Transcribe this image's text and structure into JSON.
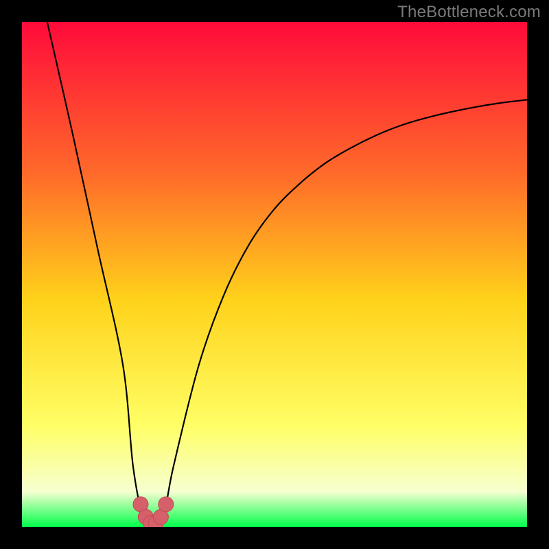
{
  "watermark": "TheBottleneck.com",
  "colors": {
    "frame": "#000000",
    "gradient_top": "#ff0a3a",
    "gradient_upper_mid": "#ff6a2a",
    "gradient_mid": "#ffd21a",
    "gradient_lower": "#ffff66",
    "gradient_pale": "#f6ffd0",
    "gradient_bottom": "#00ff4a",
    "curve": "#000000",
    "marker_fill": "#d6606a",
    "marker_stroke": "#c24a56"
  },
  "chart_data": {
    "type": "line",
    "title": "",
    "xlabel": "",
    "ylabel": "",
    "xlim": [
      0,
      100
    ],
    "ylim": [
      0,
      100
    ],
    "x": [
      5,
      10,
      15,
      20,
      22,
      24,
      26,
      28,
      30,
      35,
      40,
      45,
      50,
      55,
      60,
      65,
      70,
      75,
      80,
      85,
      90,
      95,
      100
    ],
    "values": [
      100,
      78,
      55,
      32,
      12,
      2,
      0,
      2,
      12,
      32,
      46,
      56,
      63,
      68,
      72,
      75,
      77.5,
      79.5,
      81,
      82.2,
      83.2,
      84,
      84.6
    ],
    "minimum_x": 26,
    "minimum_y": 0,
    "marker_points_x": [
      23.5,
      24.5,
      25.5,
      26.5,
      27.5,
      28.5
    ],
    "marker_points_y": [
      4.5,
      2.0,
      0.8,
      0.8,
      2.0,
      4.5
    ],
    "annotations": []
  }
}
